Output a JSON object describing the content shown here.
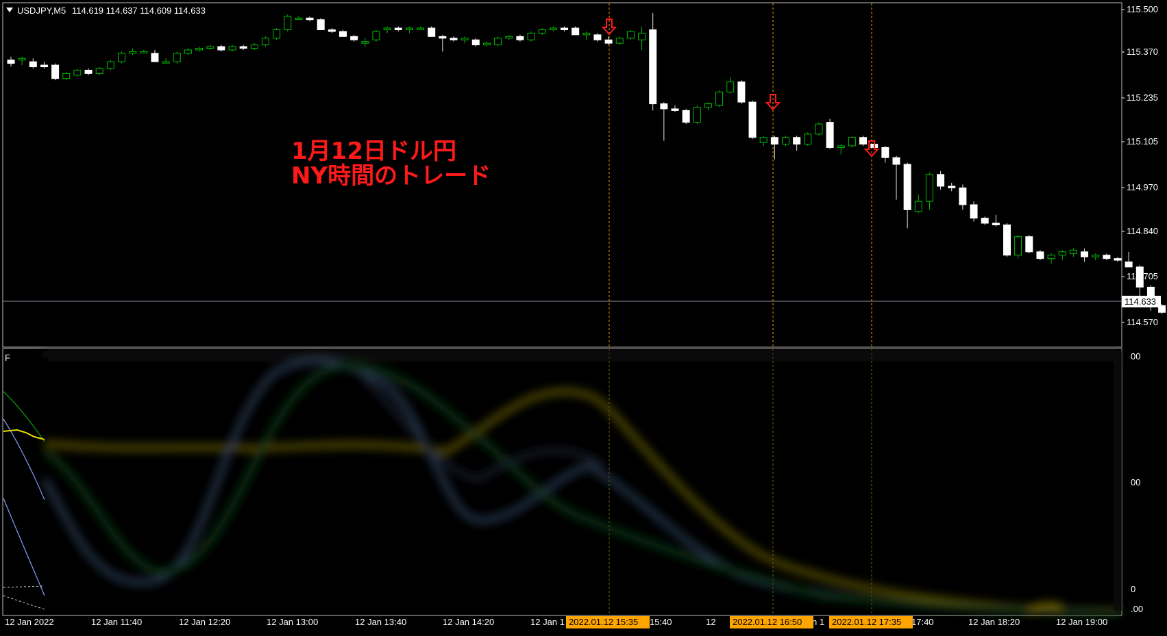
{
  "window": {
    "title": "USDJPY,M5",
    "ohlc": "114.619 114.637 114.609 114.633"
  },
  "annotation": {
    "line1": "1月12日ドル円",
    "line2": "NY時間のトレード"
  },
  "price_axis": {
    "ticks": [
      "115.500",
      "115.370",
      "115.235",
      "115.105",
      "114.970",
      "114.840",
      "114.705",
      "114.570"
    ],
    "current_price": "114.633"
  },
  "indicator_axis": {
    "ticks": [
      "00",
      "00",
      "0",
      ".00"
    ]
  },
  "time_axis": {
    "labels": [
      "12 Jan 2022",
      "12 Jan 11:40",
      "12 Jan 12:20",
      "12 Jan 13:00",
      "12 Jan 13:40",
      "12 Jan 14:20",
      "12 Jan 1",
      "15:40",
      "12",
      "n 1",
      "17:40",
      "12 Jan 18:20",
      "12 Jan 19:00"
    ],
    "tags": [
      "2022.01.12 15:35",
      "2022.01.12 16:50",
      "2022.01.12 17:35"
    ]
  },
  "colors": {
    "background": "#000000",
    "bull_candle": "#00c000",
    "bear_candle": "#ffffff",
    "arrow": "#ff1a1a",
    "vline": "#ff9900",
    "tag": "#ffa500",
    "indicator_yellow": "#e0d000",
    "indicator_blue": "#7080c0",
    "indicator_green": "#108010"
  },
  "chart_data": {
    "type": "candlestick",
    "symbol": "USDJPY",
    "timeframe": "M5",
    "ylim": [
      114.53,
      115.52
    ],
    "signals": [
      "2022.01.12 15:35",
      "2022.01.12 16:50",
      "2022.01.12 17:35"
    ],
    "candles": [
      {
        "o": 115.35,
        "h": 115.36,
        "l": 115.33,
        "c": 115.34
      },
      {
        "o": 115.35,
        "h": 115.36,
        "l": 115.335,
        "c": 115.355
      },
      {
        "o": 115.345,
        "h": 115.355,
        "l": 115.325,
        "c": 115.33
      },
      {
        "o": 115.335,
        "h": 115.345,
        "l": 115.325,
        "c": 115.33
      },
      {
        "o": 115.335,
        "h": 115.34,
        "l": 115.29,
        "c": 115.295
      },
      {
        "o": 115.295,
        "h": 115.315,
        "l": 115.29,
        "c": 115.31
      },
      {
        "o": 115.305,
        "h": 115.325,
        "l": 115.3,
        "c": 115.32
      },
      {
        "o": 115.32,
        "h": 115.325,
        "l": 115.305,
        "c": 115.31
      },
      {
        "o": 115.31,
        "h": 115.33,
        "l": 115.305,
        "c": 115.325
      },
      {
        "o": 115.325,
        "h": 115.35,
        "l": 115.32,
        "c": 115.345
      },
      {
        "o": 115.345,
        "h": 115.375,
        "l": 115.34,
        "c": 115.37
      },
      {
        "o": 115.37,
        "h": 115.385,
        "l": 115.365,
        "c": 115.375
      },
      {
        "o": 115.375,
        "h": 115.38,
        "l": 115.37,
        "c": 115.375
      },
      {
        "o": 115.37,
        "h": 115.38,
        "l": 115.345,
        "c": 115.345
      },
      {
        "o": 115.345,
        "h": 115.355,
        "l": 115.34,
        "c": 115.345
      },
      {
        "o": 115.345,
        "h": 115.375,
        "l": 115.34,
        "c": 115.37
      },
      {
        "o": 115.37,
        "h": 115.385,
        "l": 115.365,
        "c": 115.38
      },
      {
        "o": 115.38,
        "h": 115.39,
        "l": 115.375,
        "c": 115.385
      },
      {
        "o": 115.385,
        "h": 115.395,
        "l": 115.38,
        "c": 115.39
      },
      {
        "o": 115.39,
        "h": 115.395,
        "l": 115.375,
        "c": 115.38
      },
      {
        "o": 115.38,
        "h": 115.395,
        "l": 115.375,
        "c": 115.39
      },
      {
        "o": 115.39,
        "h": 115.395,
        "l": 115.38,
        "c": 115.385
      },
      {
        "o": 115.385,
        "h": 115.4,
        "l": 115.38,
        "c": 115.395
      },
      {
        "o": 115.395,
        "h": 115.42,
        "l": 115.39,
        "c": 115.415
      },
      {
        "o": 115.415,
        "h": 115.445,
        "l": 115.41,
        "c": 115.44
      },
      {
        "o": 115.44,
        "h": 115.485,
        "l": 115.435,
        "c": 115.48
      },
      {
        "o": 115.475,
        "h": 115.48,
        "l": 115.47,
        "c": 115.475
      },
      {
        "o": 115.475,
        "h": 115.48,
        "l": 115.465,
        "c": 115.47
      },
      {
        "o": 115.47,
        "h": 115.475,
        "l": 115.44,
        "c": 115.44
      },
      {
        "o": 115.44,
        "h": 115.445,
        "l": 115.43,
        "c": 115.435
      },
      {
        "o": 115.435,
        "h": 115.44,
        "l": 115.42,
        "c": 115.42
      },
      {
        "o": 115.42,
        "h": 115.425,
        "l": 115.405,
        "c": 115.41
      },
      {
        "o": 115.4,
        "h": 115.415,
        "l": 115.39,
        "c": 115.405
      },
      {
        "o": 115.41,
        "h": 115.44,
        "l": 115.405,
        "c": 115.435
      },
      {
        "o": 115.44,
        "h": 115.45,
        "l": 115.43,
        "c": 115.445
      },
      {
        "o": 115.445,
        "h": 115.45,
        "l": 115.435,
        "c": 115.44
      },
      {
        "o": 115.44,
        "h": 115.45,
        "l": 115.43,
        "c": 115.445
      },
      {
        "o": 115.445,
        "h": 115.45,
        "l": 115.44,
        "c": 115.445
      },
      {
        "o": 115.445,
        "h": 115.45,
        "l": 115.42,
        "c": 115.42
      },
      {
        "o": 115.42,
        "h": 115.425,
        "l": 115.375,
        "c": 115.415
      },
      {
        "o": 115.415,
        "h": 115.42,
        "l": 115.405,
        "c": 115.41
      },
      {
        "o": 115.41,
        "h": 115.42,
        "l": 115.4,
        "c": 115.415
      },
      {
        "o": 115.41,
        "h": 115.415,
        "l": 115.39,
        "c": 115.395
      },
      {
        "o": 115.395,
        "h": 115.405,
        "l": 115.39,
        "c": 115.4
      },
      {
        "o": 115.395,
        "h": 115.42,
        "l": 115.39,
        "c": 115.415
      },
      {
        "o": 115.415,
        "h": 115.425,
        "l": 115.41,
        "c": 115.42
      },
      {
        "o": 115.42,
        "h": 115.425,
        "l": 115.405,
        "c": 115.41
      },
      {
        "o": 115.41,
        "h": 115.435,
        "l": 115.405,
        "c": 115.43
      },
      {
        "o": 115.43,
        "h": 115.445,
        "l": 115.425,
        "c": 115.44
      },
      {
        "o": 115.44,
        "h": 115.45,
        "l": 115.435,
        "c": 115.445
      },
      {
        "o": 115.445,
        "h": 115.45,
        "l": 115.435,
        "c": 115.44
      },
      {
        "o": 115.445,
        "h": 115.45,
        "l": 115.425,
        "c": 115.425
      },
      {
        "o": 115.425,
        "h": 115.435,
        "l": 115.41,
        "c": 115.43
      },
      {
        "o": 115.425,
        "h": 115.43,
        "l": 115.405,
        "c": 115.41
      },
      {
        "o": 115.41,
        "h": 115.42,
        "l": 115.395,
        "c": 115.4
      },
      {
        "o": 115.4,
        "h": 115.42,
        "l": 115.395,
        "c": 115.415
      },
      {
        "o": 115.415,
        "h": 115.44,
        "l": 115.41,
        "c": 115.435
      },
      {
        "o": 115.41,
        "h": 115.45,
        "l": 115.38,
        "c": 115.43
      },
      {
        "o": 115.44,
        "h": 115.49,
        "l": 115.2,
        "c": 115.22
      },
      {
        "o": 115.22,
        "h": 115.225,
        "l": 115.11,
        "c": 115.205
      },
      {
        "o": 115.205,
        "h": 115.215,
        "l": 115.195,
        "c": 115.2
      },
      {
        "o": 115.2,
        "h": 115.205,
        "l": 115.16,
        "c": 115.165
      },
      {
        "o": 115.165,
        "h": 115.215,
        "l": 115.16,
        "c": 115.21
      },
      {
        "o": 115.21,
        "h": 115.225,
        "l": 115.2,
        "c": 115.22
      },
      {
        "o": 115.215,
        "h": 115.26,
        "l": 115.21,
        "c": 115.255
      },
      {
        "o": 115.255,
        "h": 115.3,
        "l": 115.25,
        "c": 115.285
      },
      {
        "o": 115.285,
        "h": 115.29,
        "l": 115.22,
        "c": 115.225
      },
      {
        "o": 115.225,
        "h": 115.23,
        "l": 115.115,
        "c": 115.12
      },
      {
        "o": 115.105,
        "h": 115.125,
        "l": 115.095,
        "c": 115.12
      },
      {
        "o": 115.12,
        "h": 115.125,
        "l": 115.055,
        "c": 115.1
      },
      {
        "o": 115.1,
        "h": 115.125,
        "l": 115.095,
        "c": 115.12
      },
      {
        "o": 115.12,
        "h": 115.125,
        "l": 115.08,
        "c": 115.1
      },
      {
        "o": 115.1,
        "h": 115.135,
        "l": 115.095,
        "c": 115.13
      },
      {
        "o": 115.13,
        "h": 115.165,
        "l": 115.125,
        "c": 115.16
      },
      {
        "o": 115.165,
        "h": 115.175,
        "l": 115.085,
        "c": 115.09
      },
      {
        "o": 115.09,
        "h": 115.1,
        "l": 115.07,
        "c": 115.095
      },
      {
        "o": 115.095,
        "h": 115.125,
        "l": 115.09,
        "c": 115.12
      },
      {
        "o": 115.12,
        "h": 115.125,
        "l": 115.095,
        "c": 115.1
      },
      {
        "o": 115.1,
        "h": 115.11,
        "l": 115.085,
        "c": 115.09
      },
      {
        "o": 115.09,
        "h": 115.095,
        "l": 115.045,
        "c": 115.06
      },
      {
        "o": 115.06,
        "h": 115.065,
        "l": 114.935,
        "c": 115.04
      },
      {
        "o": 115.04,
        "h": 115.045,
        "l": 114.85,
        "c": 114.905
      },
      {
        "o": 114.9,
        "h": 114.95,
        "l": 114.895,
        "c": 114.93
      },
      {
        "o": 114.93,
        "h": 115.015,
        "l": 114.905,
        "c": 115.01
      },
      {
        "o": 115.01,
        "h": 115.02,
        "l": 114.965,
        "c": 114.975
      },
      {
        "o": 114.975,
        "h": 114.985,
        "l": 114.96,
        "c": 114.97
      },
      {
        "o": 114.97,
        "h": 114.98,
        "l": 114.905,
        "c": 114.92
      },
      {
        "o": 114.92,
        "h": 114.93,
        "l": 114.87,
        "c": 114.88
      },
      {
        "o": 114.88,
        "h": 114.885,
        "l": 114.86,
        "c": 114.865
      },
      {
        "o": 114.865,
        "h": 114.89,
        "l": 114.855,
        "c": 114.86
      },
      {
        "o": 114.86,
        "h": 114.865,
        "l": 114.765,
        "c": 114.77
      },
      {
        "o": 114.77,
        "h": 114.83,
        "l": 114.76,
        "c": 114.825
      },
      {
        "o": 114.825,
        "h": 114.83,
        "l": 114.775,
        "c": 114.78
      },
      {
        "o": 114.78,
        "h": 114.785,
        "l": 114.755,
        "c": 114.76
      },
      {
        "o": 114.76,
        "h": 114.775,
        "l": 114.745,
        "c": 114.77
      },
      {
        "o": 114.77,
        "h": 114.785,
        "l": 114.755,
        "c": 114.78
      },
      {
        "o": 114.775,
        "h": 114.79,
        "l": 114.765,
        "c": 114.785
      },
      {
        "o": 114.78,
        "h": 114.79,
        "l": 114.75,
        "c": 114.765
      },
      {
        "o": 114.765,
        "h": 114.775,
        "l": 114.755,
        "c": 114.77
      },
      {
        "o": 114.77,
        "h": 114.775,
        "l": 114.755,
        "c": 114.76
      },
      {
        "o": 114.76,
        "h": 114.765,
        "l": 114.75,
        "c": 114.755
      },
      {
        "o": 114.75,
        "h": 114.78,
        "l": 114.735,
        "c": 114.735
      },
      {
        "o": 114.735,
        "h": 114.74,
        "l": 114.645,
        "c": 114.675
      },
      {
        "o": 114.675,
        "h": 114.68,
        "l": 114.605,
        "c": 114.62
      },
      {
        "o": 114.62,
        "h": 114.625,
        "l": 114.595,
        "c": 114.6
      },
      {
        "o": 114.6,
        "h": 114.605,
        "l": 114.585,
        "c": 114.585
      },
      {
        "o": 114.585,
        "h": 114.63,
        "l": 114.58,
        "c": 114.63
      }
    ]
  }
}
